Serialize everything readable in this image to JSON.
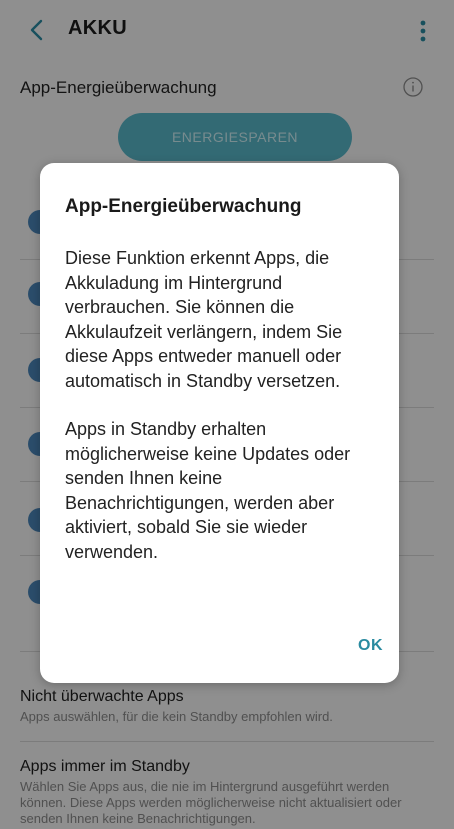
{
  "header": {
    "title": "AKKU",
    "back_icon": "chevron-left-icon",
    "more_icon": "more-vertical-icon"
  },
  "monitor": {
    "label": "App-Energieüberwachung",
    "info_icon": "info-icon"
  },
  "energy_save_button": "ENERGIESPAREN",
  "list": {
    "unmonitored": {
      "title": "Nicht überwachte Apps",
      "subtitle": "Apps auswählen, für die kein Standby empfohlen wird."
    },
    "always_standby": {
      "title": "Apps immer im Standby",
      "subtitle": "Wählen Sie Apps aus, die nie im Hintergrund ausgeführt werden können. Diese Apps werden möglicherweise nicht aktualisiert oder senden Ihnen keine Benachrichtigungen."
    }
  },
  "dialog": {
    "title": "App-Energieüberwachung",
    "paragraph1": "Diese Funktion erkennt Apps, die Akkuladung im Hintergrund verbrauchen. Sie können die Akkulaufzeit verlängern, indem Sie diese Apps entweder manuell oder automatisch in Standby versetzen.",
    "paragraph2": "Apps in Standby erhalten möglicherweise keine Updates oder senden Ihnen keine Benachrichtigungen, werden aber aktiviert, sobald Sie sie wieder verwenden.",
    "ok_label": "OK"
  },
  "colors": {
    "accent": "#2a8ba0",
    "button_bg": "#58b7c9",
    "checkbox": "#4a86b8"
  }
}
